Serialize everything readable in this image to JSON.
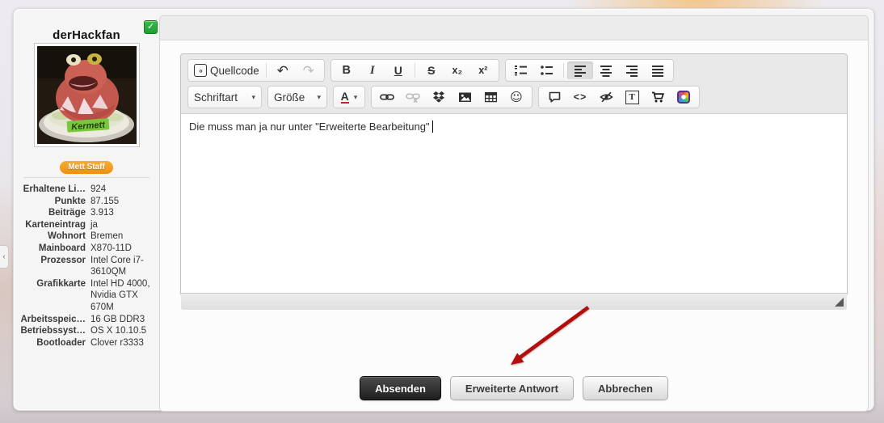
{
  "sidebar": {
    "username": "derHackfan",
    "checkbox": {
      "checked": true,
      "glyph": "✓"
    },
    "badge_label": "Mett Staff",
    "avatar_label": "Kermett",
    "collapse_tab_glyph": "‹",
    "stats": [
      {
        "label": "Erhaltene Li…",
        "value": "924"
      },
      {
        "label": "Punkte",
        "value": "87.155"
      },
      {
        "label": "Beiträge",
        "value": "3.913"
      },
      {
        "label": "Karteneintrag",
        "value": "ja"
      },
      {
        "label": "Wohnort",
        "value": "Bremen"
      },
      {
        "label": "Mainboard",
        "value": "X870-11D"
      },
      {
        "label": "Prozessor",
        "value": "Intel Core i7-3610QM"
      },
      {
        "label": "Grafikkarte",
        "value": "Intel HD 4000, Nvidia GTX 670M"
      },
      {
        "label": "Arbeitsspeic…",
        "value": "16 GB DDR3"
      },
      {
        "label": "Betriebssyst…",
        "value": "OS X 10.10.5"
      },
      {
        "label": "Bootloader",
        "value": "Clover r3333"
      }
    ]
  },
  "editor": {
    "toolbar": {
      "source_label": "Quellcode",
      "source_icon_glyph": "‹›",
      "undo_glyph": "↶",
      "redo_glyph": "↷",
      "redo_disabled": true,
      "bold_label": "B",
      "italic_label": "I",
      "underline_label": "U",
      "strike_label": "S",
      "subscript_label": "x₂",
      "superscript_label": "x²",
      "align_left_active": true,
      "font_dropdown_label": "Schriftart",
      "size_dropdown_label": "Größe",
      "color_label": "A",
      "caret_glyph": "▾",
      "unlink_disabled": true,
      "smiley_glyph": "☺",
      "code_label": "<>",
      "textframe_label": "T"
    },
    "content_text": "Die muss man ja nur unter \"Erweiterte Bearbeitung\""
  },
  "actions": {
    "submit_label": "Absenden",
    "extended_label": "Erweiterte Antwort",
    "cancel_label": "Abbrechen"
  },
  "colors": {
    "badge_orange": "#f09a1c",
    "checkbox_green": "#2bad3c",
    "arrow_red": "#b30d0d",
    "toolbar_bg": "#e9e9e9",
    "dark_button": "#2a2a2a"
  }
}
